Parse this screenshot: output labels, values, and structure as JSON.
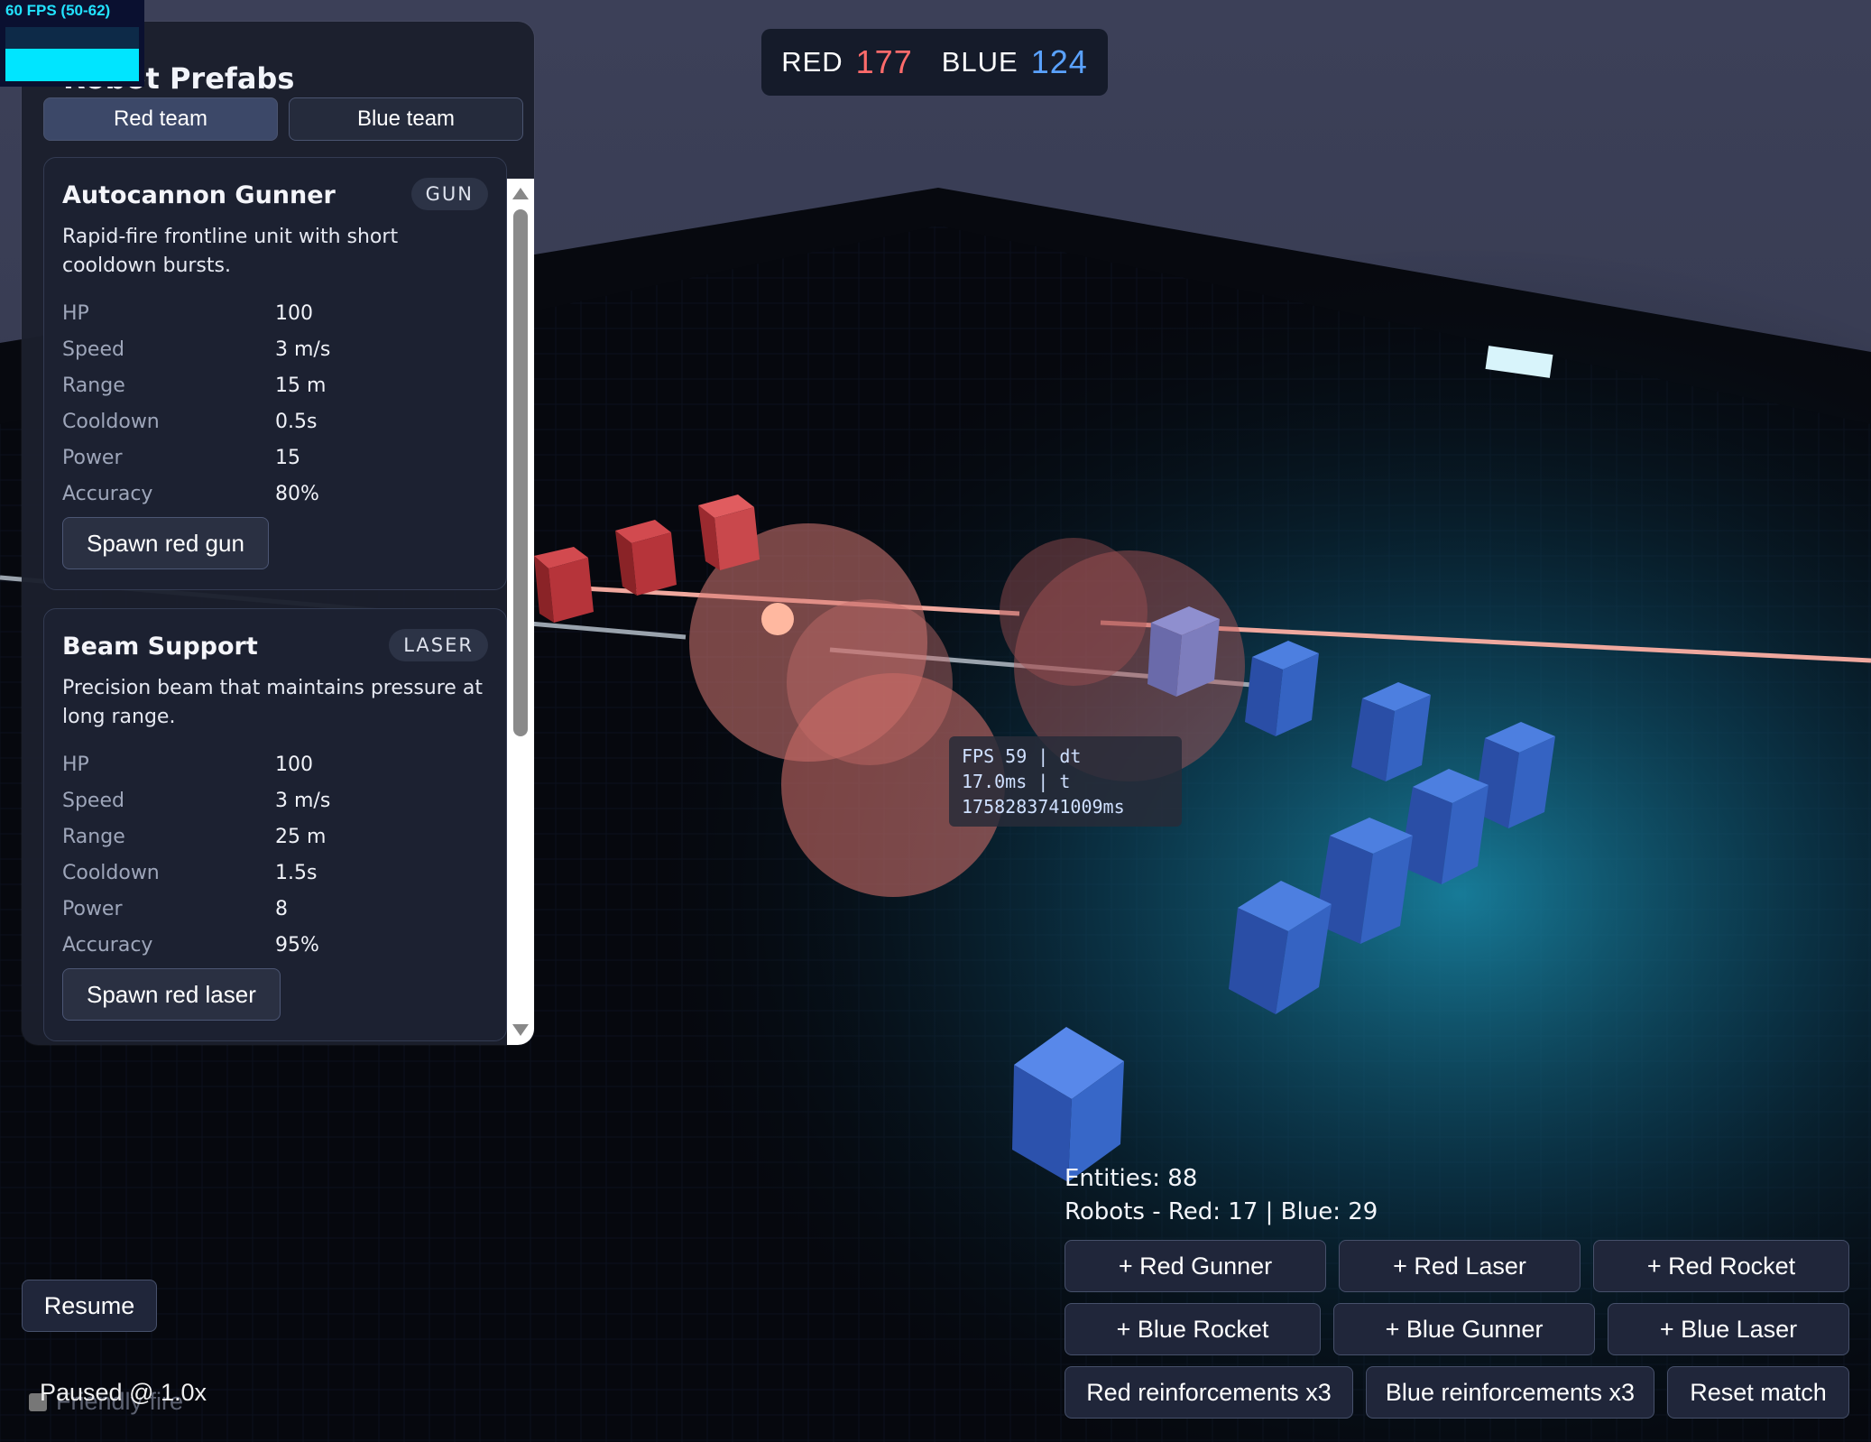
{
  "fps_counter": {
    "text": "60 FPS (50-62)"
  },
  "panel": {
    "title": "Robot Prefabs",
    "tabs": [
      {
        "label": "Red team",
        "active": true
      },
      {
        "label": "Blue team",
        "active": false
      }
    ],
    "stat_labels": [
      "HP",
      "Speed",
      "Range",
      "Cooldown",
      "Power",
      "Accuracy"
    ],
    "cards": [
      {
        "name": "Autocannon Gunner",
        "badge": "GUN",
        "description": "Rapid-fire frontline unit with short cooldown bursts.",
        "stats": [
          "100",
          "3 m/s",
          "15 m",
          "0.5s",
          "15",
          "80%"
        ],
        "spawn_label": "Spawn red gun"
      },
      {
        "name": "Beam Support",
        "badge": "LASER",
        "description": "Precision beam that maintains pressure at long range.",
        "stats": [
          "100",
          "3 m/s",
          "25 m",
          "1.5s",
          "8",
          "95%"
        ],
        "spawn_label": "Spawn red laser"
      }
    ]
  },
  "score": {
    "red_label": "RED",
    "red_value": "177",
    "blue_label": "BLUE",
    "blue_value": "124"
  },
  "debug": {
    "line1": "FPS 59 | dt",
    "line2": "17.0ms | t",
    "line3": "1758283741009ms"
  },
  "stats": {
    "entities": "Entities: 88",
    "robots": "Robots - Red: 17 | Blue: 29"
  },
  "controls": {
    "row1": [
      "+ Red Gunner",
      "+ Red Laser",
      "+ Red Rocket"
    ],
    "row2": [
      "+ Blue Rocket",
      "+ Blue Gunner",
      "+ Blue Laser"
    ],
    "row3": [
      "Red reinforcements x3",
      "Blue reinforcements x3",
      "Reset match"
    ]
  },
  "bottom_left": {
    "resume_label": "Resume",
    "friendly_fire_label": "Friendly fire",
    "friendly_fire_checked": false,
    "status_text": "Paused @ 1.0x"
  },
  "colors": {
    "red_team": "#c0393f",
    "blue_team": "#3a6ad0",
    "red_score": "#ff6b6b",
    "blue_score": "#5aa2ff",
    "fps_accent": "#00e5ff"
  }
}
